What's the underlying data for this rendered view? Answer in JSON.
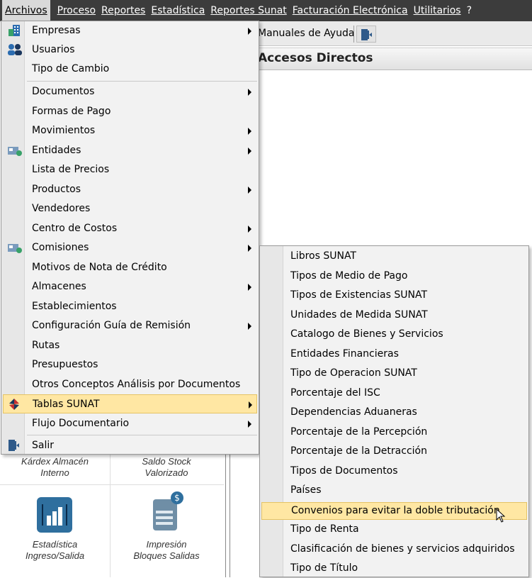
{
  "menubar": {
    "items": [
      {
        "label": "Archivos"
      },
      {
        "label": "Proceso"
      },
      {
        "label": "Reportes"
      },
      {
        "label": "Estadística"
      },
      {
        "label": "Reportes Sunat"
      },
      {
        "label": "Facturación Electrónica"
      },
      {
        "label": "Utilitarios"
      },
      {
        "label": "?"
      }
    ]
  },
  "toolbar": {
    "manuales_label": "Manuales de Ayuda",
    "exit_icon": "door-exit-icon"
  },
  "accesos": {
    "title": "Accesos Directos"
  },
  "tiles": [
    {
      "label_line1": "Kárdex Almacén",
      "label_line2": "Interno"
    },
    {
      "label_line1": "Saldo Stock",
      "label_line2": "Valorizado"
    },
    {
      "label_line1": "Estadística",
      "label_line2": "Ingreso/Salida",
      "icon": "bar-chart-icon"
    },
    {
      "label_line1": "Impresión",
      "label_line2": "Bloques Salidas",
      "icon": "document-dollar-icon"
    }
  ],
  "archivos_menu": {
    "items": [
      {
        "label": "Empresas",
        "submenu": true,
        "icon": "building-icon"
      },
      {
        "label": "Usuarios",
        "submenu": false,
        "icon": "users-icon"
      },
      {
        "label": "Tipo de Cambio",
        "submenu": false
      },
      {
        "label": "Documentos",
        "submenu": true
      },
      {
        "label": "Formas de Pago",
        "submenu": false
      },
      {
        "label": "Movimientos",
        "submenu": true
      },
      {
        "label": "Entidades",
        "submenu": true,
        "icon": "entity-card-icon"
      },
      {
        "label": "Lista de Precios",
        "submenu": false
      },
      {
        "label": "Productos",
        "submenu": true
      },
      {
        "label": "Vendedores",
        "submenu": false
      },
      {
        "label": "Centro de Costos",
        "submenu": true
      },
      {
        "label": "Comisiones",
        "submenu": true,
        "icon": "entity-card-icon"
      },
      {
        "label": "Motivos de Nota de Crédito",
        "submenu": false
      },
      {
        "label": "Almacenes",
        "submenu": true
      },
      {
        "label": "Establecimientos",
        "submenu": false
      },
      {
        "label": "Configuración Guía de Remisión",
        "submenu": true
      },
      {
        "label": "Rutas",
        "submenu": false
      },
      {
        "label": "Presupuestos",
        "submenu": false
      },
      {
        "label": "Otros Conceptos Análisis por Documentos",
        "submenu": false
      },
      {
        "label": "Tablas SUNAT",
        "submenu": true,
        "icon": "sunat-logo-icon",
        "highlighted": true
      },
      {
        "label": "Flujo Documentario",
        "submenu": true
      },
      {
        "label": "Salir",
        "submenu": false,
        "icon": "door-exit-icon"
      }
    ]
  },
  "tablas_sunat_menu": {
    "items": [
      {
        "label": "Libros SUNAT"
      },
      {
        "label": "Tipos de Medio de Pago"
      },
      {
        "label": "Tipos de Existencias SUNAT"
      },
      {
        "label": "Unidades de Medida SUNAT"
      },
      {
        "label": "Catalogo de Bienes y Servicios"
      },
      {
        "label": "Entidades Financieras"
      },
      {
        "label": "Tipo de Operacion SUNAT"
      },
      {
        "label": "Porcentaje del ISC"
      },
      {
        "label": "Dependencias Aduaneras"
      },
      {
        "label": "Porcentaje de la Percepción"
      },
      {
        "label": "Porcentaje de la Detracción"
      },
      {
        "label": "Tipos de Documentos"
      },
      {
        "label": "Países"
      },
      {
        "label": "Convenios para evitar la doble tributación",
        "highlighted": true
      },
      {
        "label": "Tipo de Renta"
      },
      {
        "label": "Clasificación de bienes y servicios adquiridos"
      },
      {
        "label": "Tipo de Título"
      }
    ]
  },
  "colors": {
    "menubar_bg": "#3c3c3c",
    "highlight_bg": "#ffe7a3",
    "highlight_border": "#e5c365",
    "menu_bg": "#f2f2f2"
  }
}
